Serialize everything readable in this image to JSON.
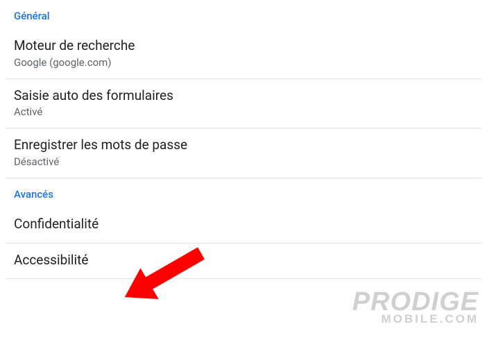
{
  "sections": {
    "general": {
      "header": "Général",
      "items": [
        {
          "title": "Moteur de recherche",
          "subtitle": "Google (google.com)"
        },
        {
          "title": "Saisie auto des formulaires",
          "subtitle": "Activé"
        },
        {
          "title": "Enregistrer les mots de passe",
          "subtitle": "Désactivé"
        }
      ]
    },
    "advanced": {
      "header": "Avancés",
      "items": [
        {
          "title": "Confidentialité"
        },
        {
          "title": "Accessibilité"
        }
      ]
    }
  },
  "watermark": {
    "line1": "PRODIGE",
    "line2": "MOBILE.COM"
  },
  "annotation": {
    "arrow_color": "#ff0000"
  }
}
